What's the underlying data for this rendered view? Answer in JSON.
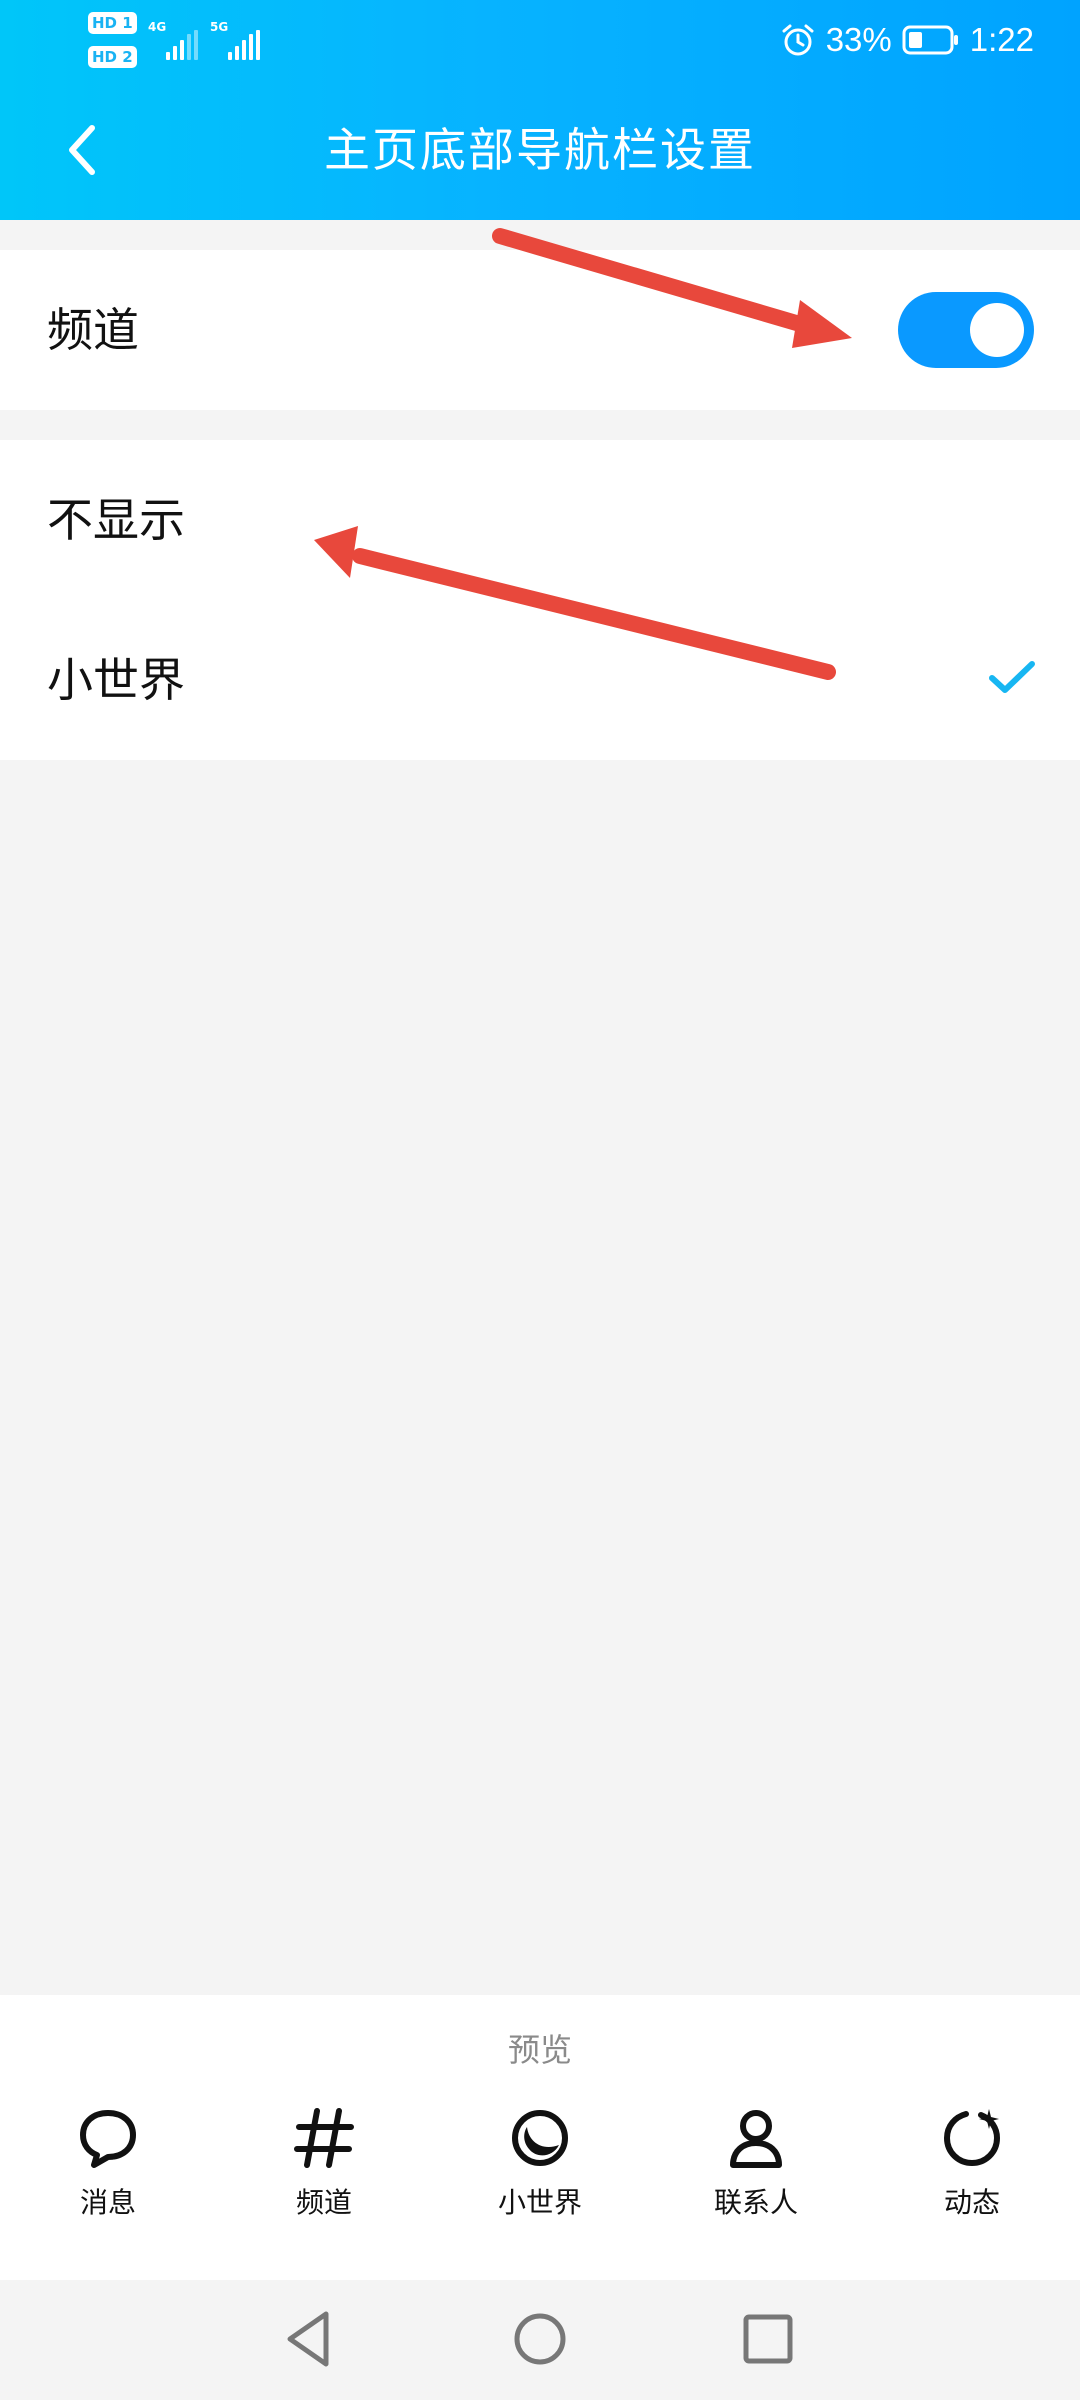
{
  "status_bar": {
    "sim1_badge": "HD 1",
    "sim2_badge": "HD 2",
    "network1": "4G",
    "network2": "5G",
    "battery_percent": "33%",
    "time": "1:22",
    "battery_level": 0.33
  },
  "header": {
    "title": "主页底部导航栏设置",
    "back_icon": "chevron-left-icon"
  },
  "channel_setting": {
    "label": "频道",
    "toggle_on": true
  },
  "options": [
    {
      "label": "不显示",
      "selected": false
    },
    {
      "label": "小世界",
      "selected": true
    }
  ],
  "preview": {
    "label": "预览",
    "tabs": [
      {
        "label": "消息",
        "icon": "chat-bubble-icon"
      },
      {
        "label": "频道",
        "icon": "hash-icon"
      },
      {
        "label": "小世界",
        "icon": "crescent-icon"
      },
      {
        "label": "联系人",
        "icon": "person-icon"
      },
      {
        "label": "动态",
        "icon": "refresh-star-icon"
      }
    ]
  },
  "colors": {
    "header_start": "#00c6f9",
    "header_end": "#00a3ff",
    "toggle": "#0a99ff",
    "check": "#17b6f2",
    "annotation_arrow": "#e8483c",
    "background": "#f4f4f4"
  }
}
